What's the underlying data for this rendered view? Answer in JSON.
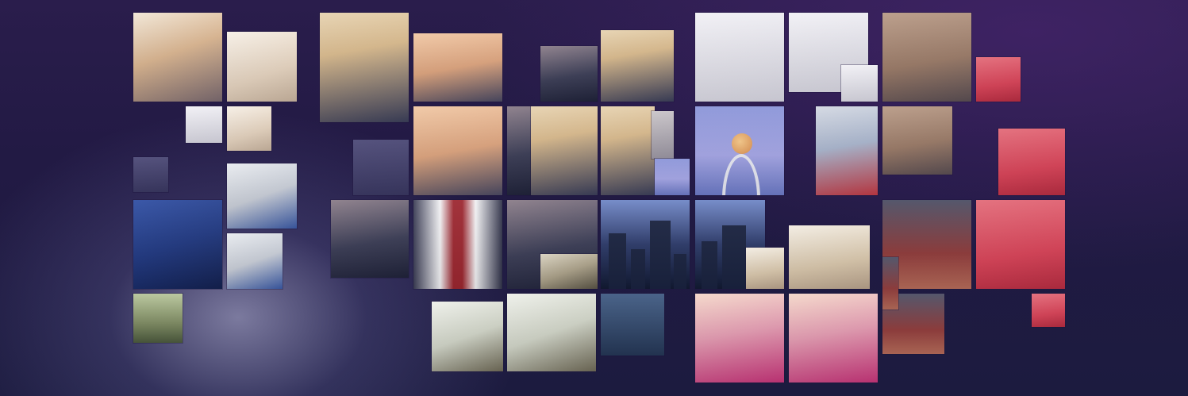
{
  "banner": {
    "background_color": "#221a44",
    "accent_color": "#2a1d4c",
    "tiles": [
      "ivanka-portrait",
      "street-scene",
      "megyn-portrait",
      "trump-ivanka-photo",
      "dinner-photo",
      "arch-moon-photo",
      "skyline-photo",
      "football-photo",
      "polar-bear-photo",
      "hillary-photo",
      "basketball-photo",
      "melania-photo",
      "tom-brady-photo",
      "rapper-photo"
    ]
  }
}
